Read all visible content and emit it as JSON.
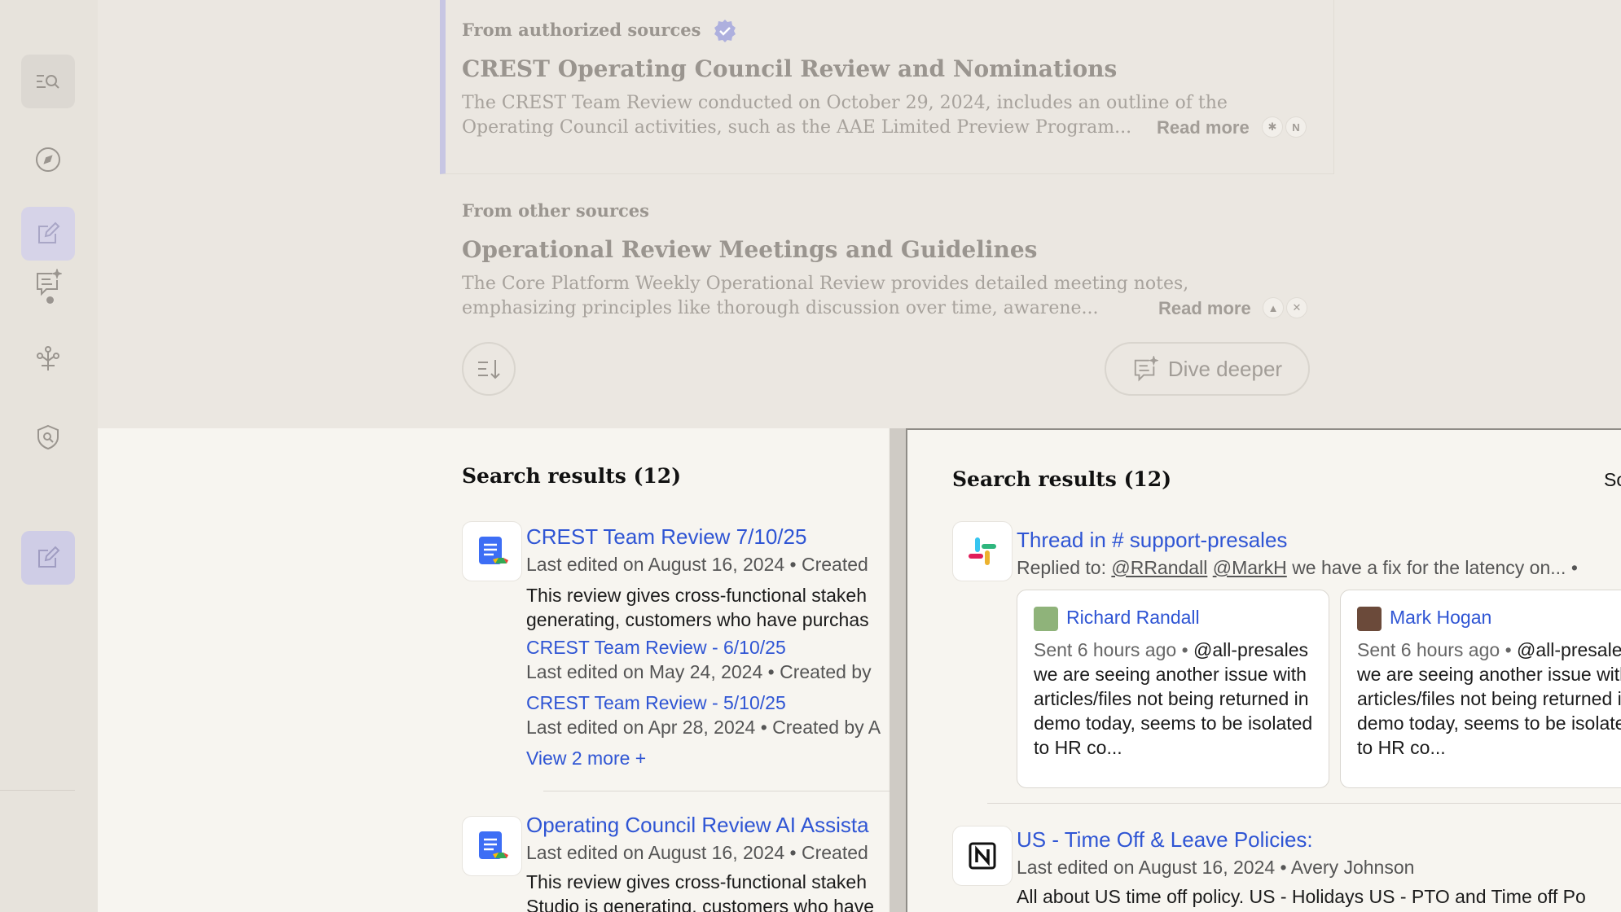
{
  "colors": {
    "accent": "#2f55d4",
    "sidebar_active": "#d6d3e8",
    "authorized_bar": "#c7c6e3"
  },
  "sidebar": {
    "items": [
      {
        "icon": "search-list-icon"
      },
      {
        "icon": "compass-icon"
      },
      {
        "icon": "edit-icon"
      },
      {
        "icon": "chat-sparkle-icon"
      },
      {
        "icon": "agents-tree-icon"
      },
      {
        "icon": "shield-search-icon"
      },
      {
        "icon": "edit-icon"
      }
    ]
  },
  "answer": {
    "authorized": {
      "label": "From authorized sources",
      "title": "CREST Operating Council Review and Nominations",
      "body_line1": "The CREST Team Review conducted on October 29, 2024, includes an outline of the",
      "body_line2": "Operating Council activities, such as the AAE Limited Preview Program...",
      "read_more": "Read more"
    },
    "other": {
      "label": "From other sources",
      "title": "Operational Review Meetings and Guidelines",
      "body_line1": "The Core Platform Weekly Operational Review provides detailed meeting notes,",
      "body_line2": "emphasizing principles like thorough discussion over time, awarene...",
      "read_more": "Read more"
    },
    "dive_deeper": "Dive deeper"
  },
  "left_results": {
    "heading": "Search results (12)",
    "items": [
      {
        "title": "CREST Team Review 7/10/25",
        "meta": "Last edited on August 16, 2024 • Created",
        "snippet_line1": "This review gives cross-functional stakeh",
        "snippet_line2": "generating, customers who have purchas",
        "sub": [
          {
            "title": "CREST Team Review - 6/10/25",
            "meta": "Last edited on May 24, 2024 • Created by"
          },
          {
            "title": "CREST Team Review - 5/10/25",
            "meta": "Last edited on Apr 28, 2024 • Created by A"
          }
        ],
        "view_more": "View 2 more +"
      },
      {
        "title": "Operating Council Review AI Assista",
        "meta": "Last edited on August 16, 2024 • Created",
        "snippet_line1": "This review gives cross-functional stakeh",
        "snippet_line2": "Studio is generating, customers who have"
      }
    ]
  },
  "right_results": {
    "heading": "Search results (12)",
    "sort_label": "So",
    "thread": {
      "title": "Thread in # support-presales",
      "replied_prefix": "Replied to:",
      "mention1": "@RRandall",
      "mention2": "@MarkH",
      "replied_rest": "we have a fix for the latency on... •",
      "messages": [
        {
          "name": "Richard Randall",
          "time": "Sent 6 hours ago •",
          "text": "@all-presales we are seeing another issue with articles/files not being returned in demo today, seems to be isolated to HR co..."
        },
        {
          "name": "Mark Hogan",
          "time": "Sent 6 hours ago •",
          "text": "@all-presales we are seeing another issue with articles/files not being returned in demo today, seems to be isolated to HR co..."
        }
      ]
    },
    "policy": {
      "title": "US - Time Off & Leave Policies:",
      "meta": "Last edited on August 16, 2024 • Avery Johnson",
      "snippet": "All about US time off policy. US - Holidays US - PTO and Time off Po"
    }
  }
}
